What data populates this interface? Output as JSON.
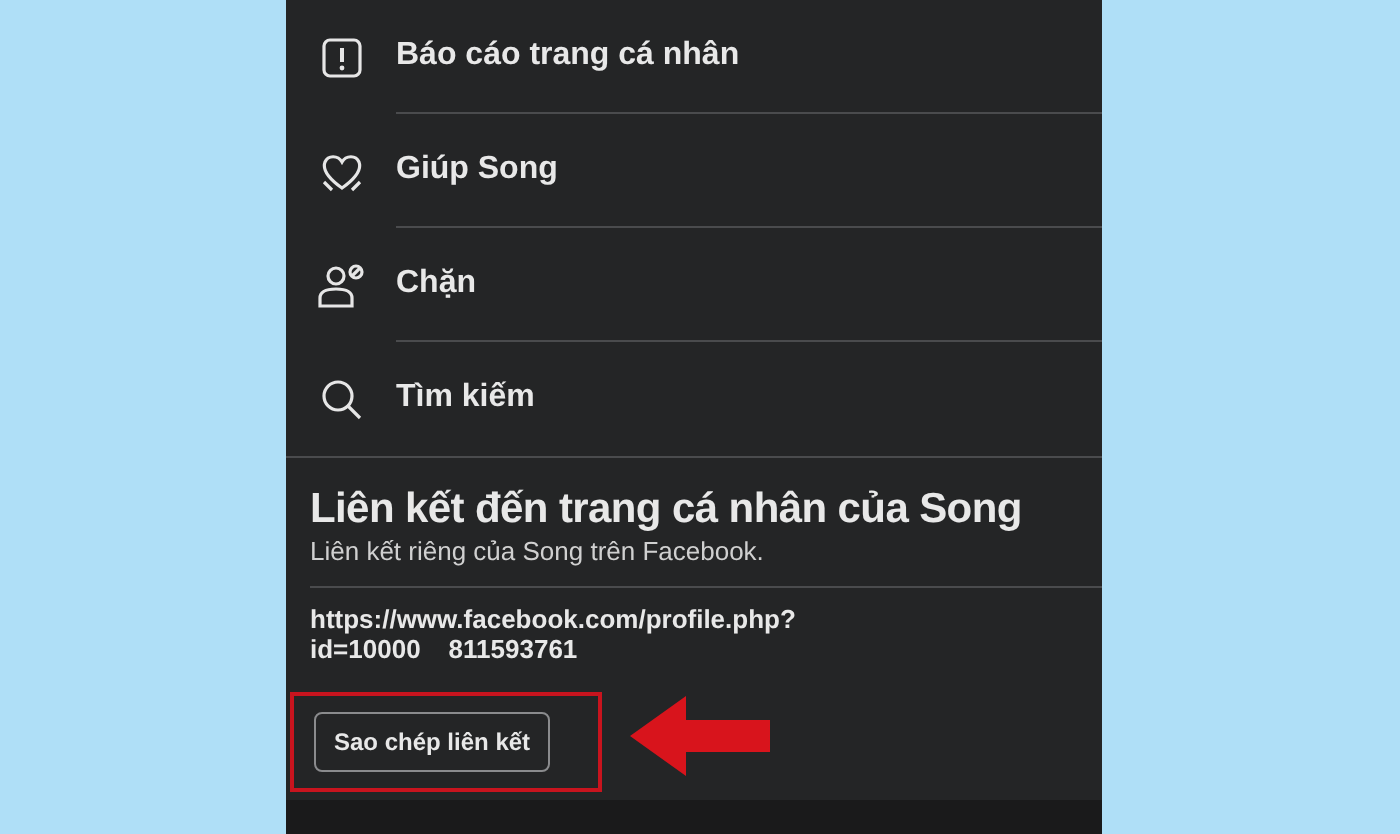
{
  "menu_items": [
    {
      "kind": "report",
      "label": "Báo cáo trang cá nhân"
    },
    {
      "kind": "heart",
      "label": "Giúp Song"
    },
    {
      "kind": "block",
      "label": "Chặn"
    },
    {
      "kind": "search",
      "label": "Tìm kiếm"
    }
  ],
  "link_section": {
    "title": "Liên kết đến trang cá nhân của Song",
    "subtitle": "Liên kết riêng của Song trên Facebook.",
    "url_lines": [
      "https://www.facebook.com/profile.php?"
    ],
    "id_parts": [
      "id=10000",
      "811593761"
    ],
    "copy_button": "Sao chép liên kết",
    "highlighted": true
  }
}
